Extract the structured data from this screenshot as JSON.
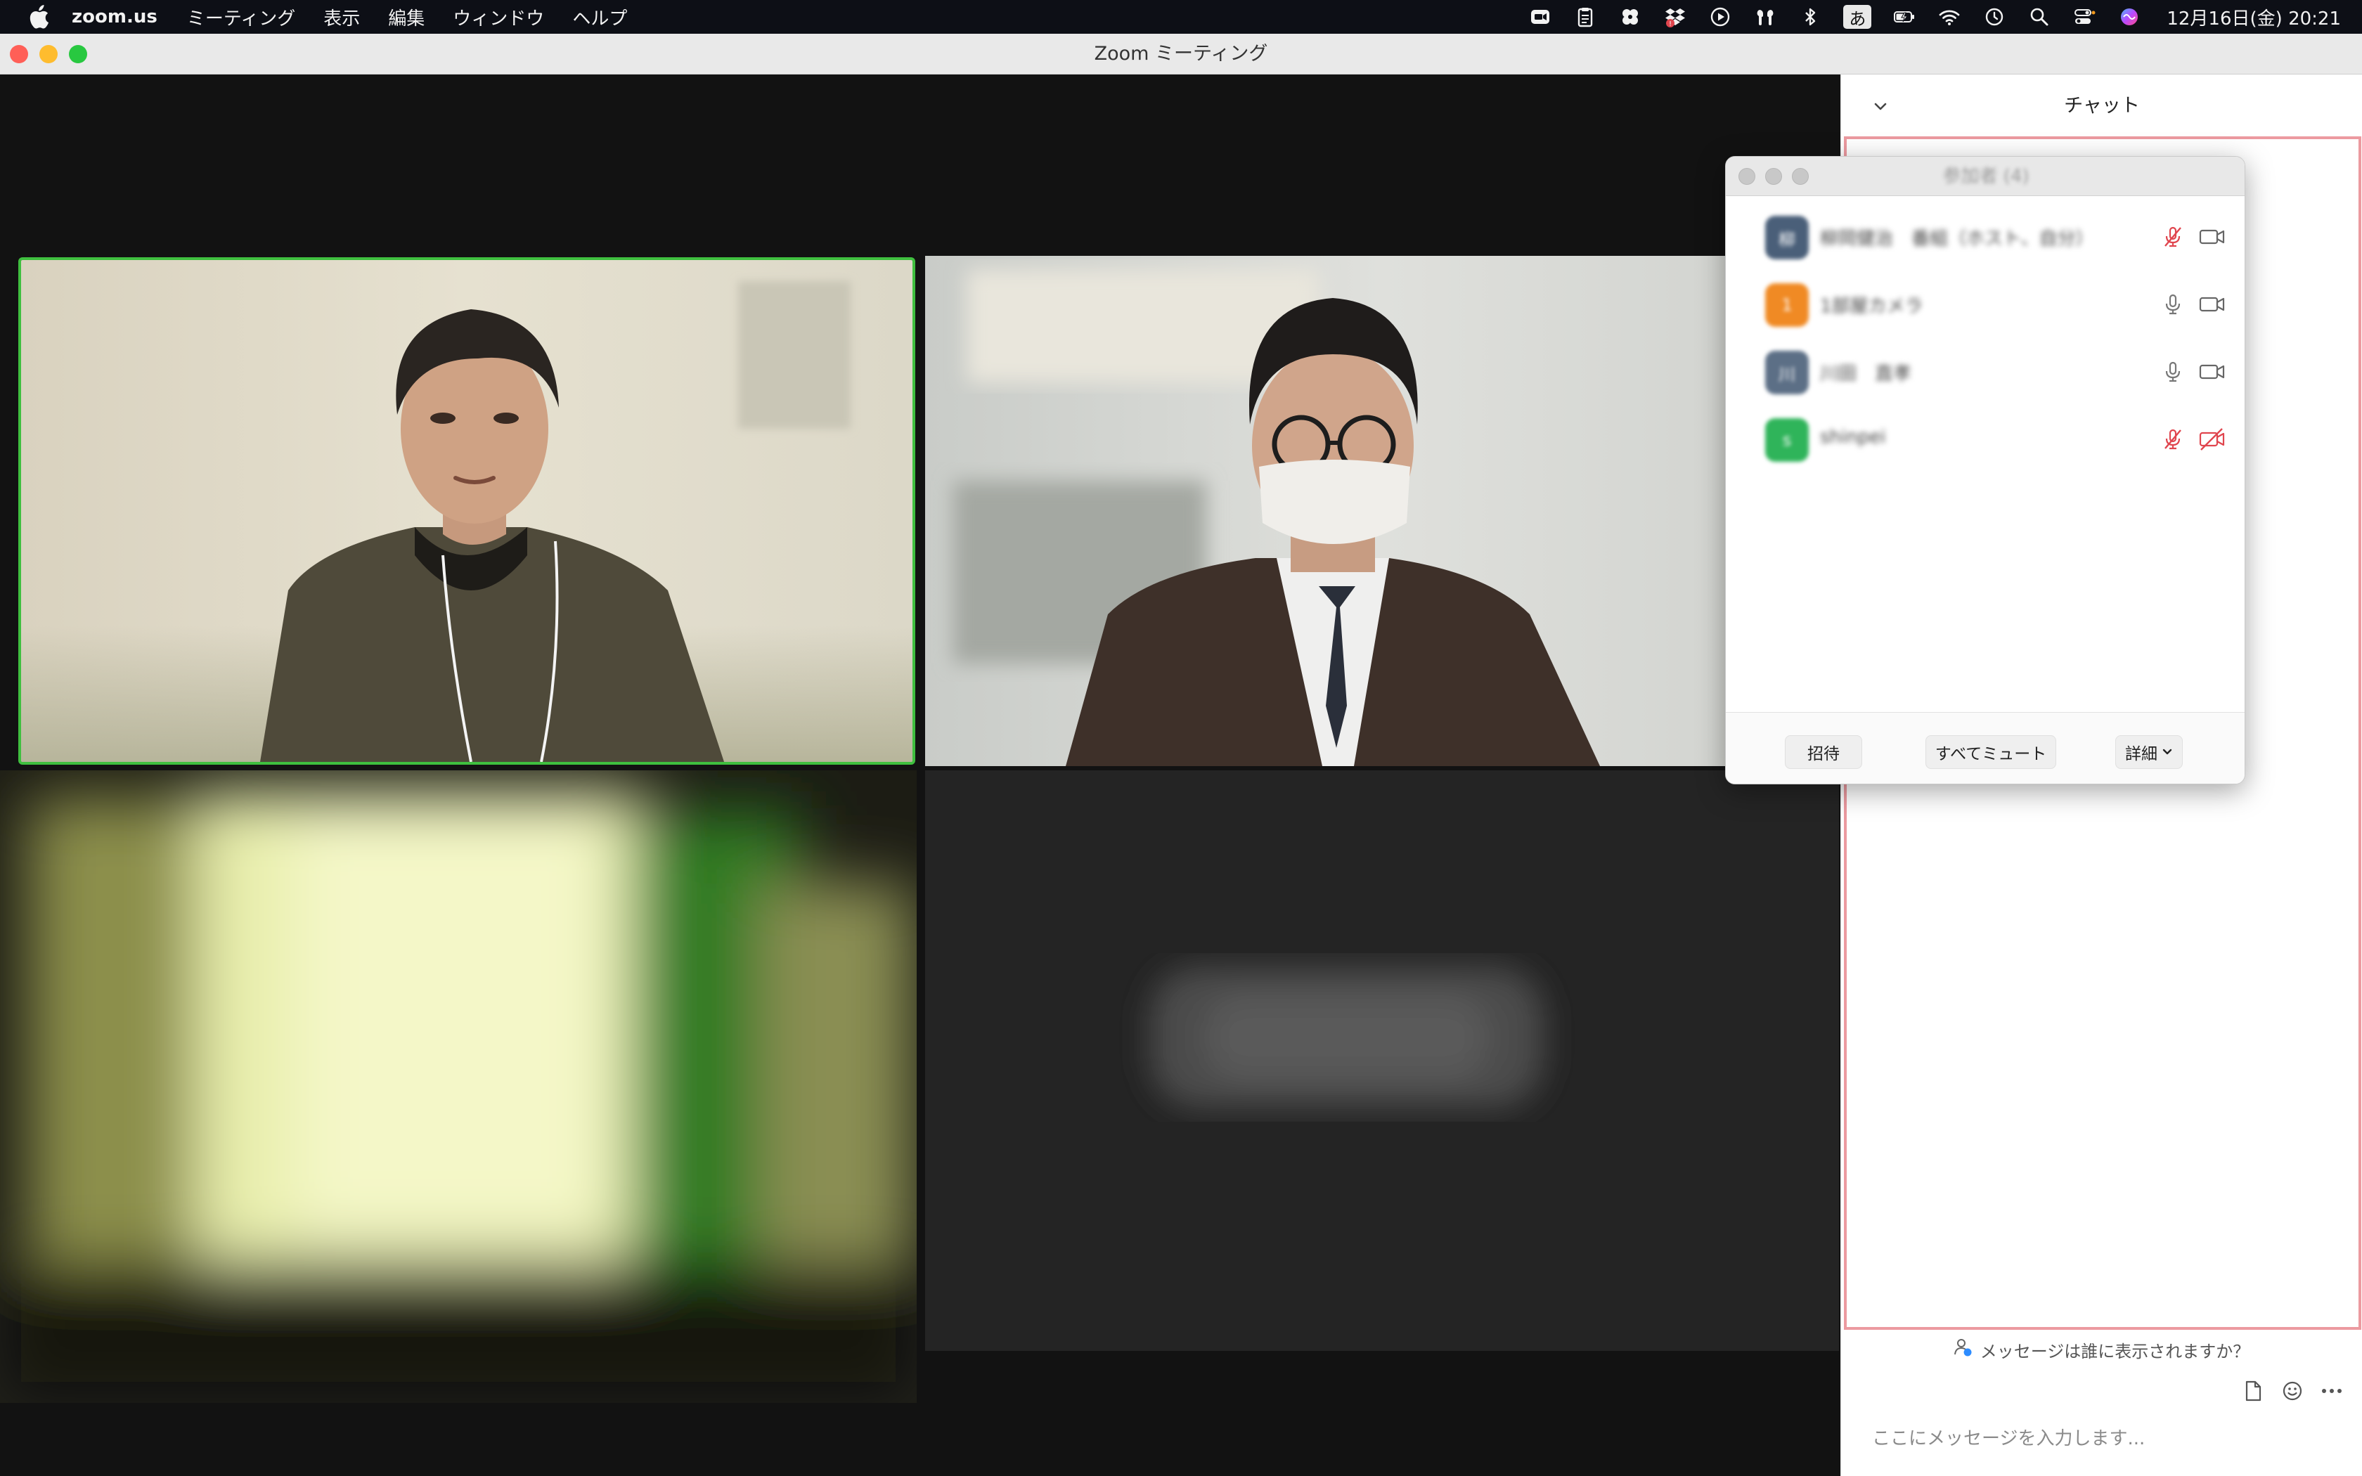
{
  "menubar": {
    "app_name": "zoom.us",
    "items": [
      "ミーティング",
      "表示",
      "編集",
      "ウィンドウ",
      "ヘルプ"
    ],
    "ime_label": "あ",
    "clock": "12月16日(金)  20:21"
  },
  "window": {
    "title": "Zoom ミーティング"
  },
  "chat": {
    "title": "チャット",
    "visibility_text": "メッセージは誰に表示されますか？",
    "input_placeholder": "ここにメッセージを入力します..."
  },
  "participants": {
    "title": "参加者 (4)",
    "list": [
      {
        "name": "柳岡健治　番組（ホスト、自分）",
        "initial": "柳",
        "avatar_color": "#4a5f79",
        "muted": true,
        "video_on": true
      },
      {
        "name": "1部屋カメラ",
        "initial": "1",
        "avatar_color": "#f08a24",
        "muted": false,
        "video_on": true
      },
      {
        "name": "川田　直孝",
        "initial": "川",
        "avatar_color": "#5c6f86",
        "muted": false,
        "video_on": true
      },
      {
        "name": "shinpei",
        "initial": "s",
        "avatar_color": "#2fb45a",
        "muted": true,
        "video_on": false
      }
    ],
    "invite_label": "招待",
    "mute_all_label": "すべてミュート",
    "more_label": "詳細"
  },
  "colors": {
    "active_speaker_border": "#3fbf3f",
    "chat_highlight_border": "#ec9aa0",
    "muted_icon": "#e0454e"
  }
}
